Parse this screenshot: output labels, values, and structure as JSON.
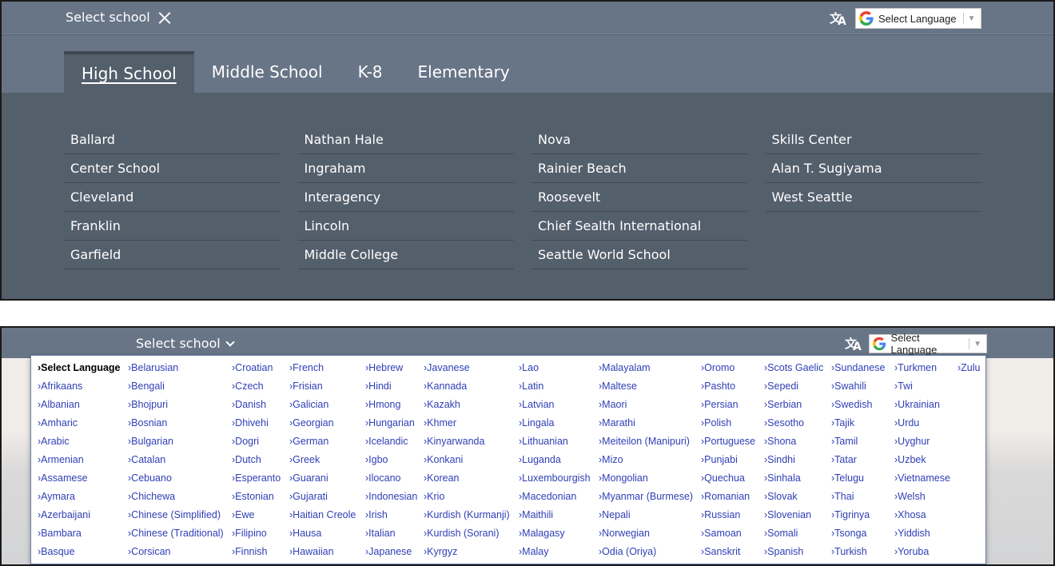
{
  "panel1": {
    "select_school": "Select school",
    "tabs": [
      "High School",
      "Middle School",
      "K-8",
      "Elementary"
    ],
    "columns": [
      [
        "Ballard",
        "Center School",
        "Cleveland",
        "Franklin",
        "Garfield"
      ],
      [
        "Nathan Hale",
        "Ingraham",
        "Interagency",
        "Lincoln",
        "Middle College"
      ],
      [
        "Nova",
        "Rainier Beach",
        "Roosevelt",
        "Chief Sealth International",
        "Seattle World School"
      ],
      [
        "Skills Center",
        "Alan T. Sugiyama",
        "West Seattle"
      ]
    ],
    "translate": {
      "label": "Select Language",
      "icon": "translate-icon"
    }
  },
  "panel2": {
    "select_school": "Select school",
    "translate": {
      "label": "Select Language",
      "icon": "translate-icon"
    },
    "language_columns": [
      [
        "›Select Language",
        "›Afrikaans",
        "›Albanian",
        "›Amharic",
        "›Arabic",
        "›Armenian",
        "›Assamese",
        "›Aymara",
        "›Azerbaijani",
        "›Bambara",
        "›Basque"
      ],
      [
        "›Belarusian",
        "›Bengali",
        "›Bhojpuri",
        "›Bosnian",
        "›Bulgarian",
        "›Catalan",
        "›Cebuano",
        "›Chichewa",
        "›Chinese (Simplified)",
        "›Chinese (Traditional)",
        "›Corsican"
      ],
      [
        "›Croatian",
        "›Czech",
        "›Danish",
        "›Dhivehi",
        "›Dogri",
        "›Dutch",
        "›Esperanto",
        "›Estonian",
        "›Ewe",
        "›Filipino",
        "›Finnish"
      ],
      [
        "›French",
        "›Frisian",
        "›Galician",
        "›Georgian",
        "›German",
        "›Greek",
        "›Guarani",
        "›Gujarati",
        "›Haitian Creole",
        "›Hausa",
        "›Hawaiian"
      ],
      [
        "›Hebrew",
        "›Hindi",
        "›Hmong",
        "›Hungarian",
        "›Icelandic",
        "›Igbo",
        "›Ilocano",
        "›Indonesian",
        "›Irish",
        "›Italian",
        "›Japanese"
      ],
      [
        "›Javanese",
        "›Kannada",
        "›Kazakh",
        "›Khmer",
        "›Kinyarwanda",
        "›Konkani",
        "›Korean",
        "›Krio",
        "›Kurdish (Kurmanji)",
        "›Kurdish (Sorani)",
        "›Kyrgyz"
      ],
      [
        "›Lao",
        "›Latin",
        "›Latvian",
        "›Lingala",
        "›Lithuanian",
        "›Luganda",
        "›Luxembourgish",
        "›Macedonian",
        "›Maithili",
        "›Malagasy",
        "›Malay"
      ],
      [
        "›Malayalam",
        "›Maltese",
        "›Maori",
        "›Marathi",
        "›Meiteilon (Manipuri)",
        "›Mizo",
        "›Mongolian",
        "›Myanmar (Burmese)",
        "›Nepali",
        "›Norwegian",
        "›Odia (Oriya)"
      ],
      [
        "›Oromo",
        "›Pashto",
        "›Persian",
        "›Polish",
        "›Portuguese",
        "›Punjabi",
        "›Quechua",
        "›Romanian",
        "›Russian",
        "›Samoan",
        "›Sanskrit"
      ],
      [
        "›Scots Gaelic",
        "›Sepedi",
        "›Serbian",
        "›Sesotho",
        "›Shona",
        "›Sindhi",
        "›Sinhala",
        "›Slovak",
        "›Slovenian",
        "›Somali",
        "›Spanish"
      ],
      [
        "›Sundanese",
        "›Swahili",
        "›Swedish",
        "›Tajik",
        "›Tamil",
        "›Tatar",
        "›Telugu",
        "›Thai",
        "›Tigrinya",
        "›Tsonga",
        "›Turkish"
      ],
      [
        "›Turkmen",
        "›Twi",
        "›Ukrainian",
        "›Urdu",
        "›Uyghur",
        "›Uzbek",
        "›Vietnamese",
        "›Welsh",
        "›Xhosa",
        "›Yiddish",
        "›Yoruba"
      ],
      [
        "›Zulu"
      ]
    ],
    "selected_language": "›Select Language"
  },
  "colors": {
    "topbar": "#687587",
    "panel_body": "#545f6c",
    "link_blue": "#2f3fb5"
  }
}
